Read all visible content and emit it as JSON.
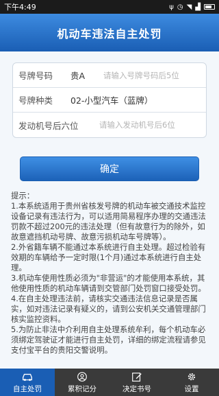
{
  "status": {
    "time": "下午4:49"
  },
  "header": {
    "title": "机动车违法自主处罚"
  },
  "form": {
    "plate": {
      "label": "号牌号码",
      "prefix": "贵A",
      "placeholder": "请输入号牌号码后5位"
    },
    "type": {
      "label": "号牌种类",
      "value": "02-小型汽车（蓝牌）"
    },
    "engine": {
      "label": "发动机号后六位",
      "placeholder": "请输入发动机号后6位"
    }
  },
  "confirm_label": "确定",
  "tips": "提示：\n1.本系统适用于贵州省核发号牌的机动车被交通技术监控设备记录有违法行为，可以适用简易程序办理的交通违法罚款不超过200元的违法处理（但有故意行为的除外，如故意遮挡机动号牌、故意污损机动车号牌等）。\n2.外省籍车辆不能通过本系统进行自主处理。超过检验有效期的车辆给予一定时限(1个月)通过本系统进行自主处理。\n3.机动车使用性质必须为\"非营运\"的才能使用本系统，其他使用性质的机动车辆请到交管部门处罚窗口接受处罚。\n4.在自主处理违法前，请核实交通违法信息记录是否属实，如对违法记录有疑义的，请到公安机关交通管理部门核实监控资料。\n5.为防止非法中介利用自主处理系统牟利，每个机动车必须绑定驾驶证才能进行自主处罚，详细的绑定流程请参见支付宝平台的贵阳交警说明。",
  "tabs": [
    {
      "label": "自主处罚",
      "icon": "car-icon",
      "active": true
    },
    {
      "label": "累积记分",
      "icon": "user-icon",
      "active": false
    },
    {
      "label": "决定书号",
      "icon": "edit-icon",
      "active": false
    },
    {
      "label": "设置",
      "icon": "gear-icon",
      "active": false
    }
  ]
}
